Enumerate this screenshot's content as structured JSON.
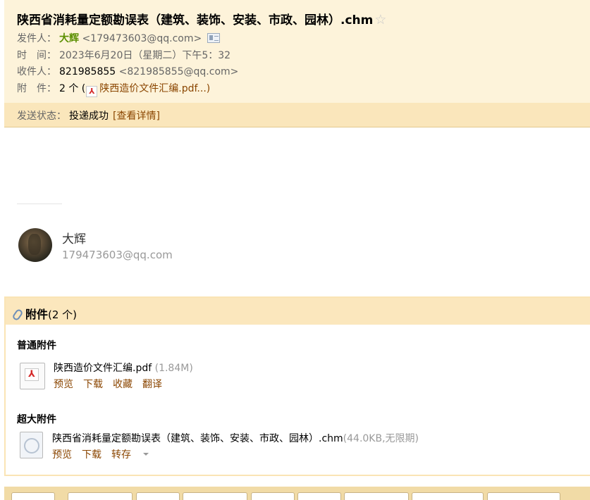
{
  "header": {
    "subject": "陕西省消耗量定额勘误表（建筑、装饰、安装、市政、园林）.chm",
    "star_icon": "☆",
    "from_label": "发件人：",
    "from_name": "大辉",
    "from_email": "<179473603@qq.com>",
    "time_label": "时　间：",
    "time_value": "2023年6月20日（星期二）下午5：32",
    "to_label": "收件人：",
    "to_name": "821985855",
    "to_email": "<821985855@qq.com>",
    "att_label": "附　件：",
    "att_count": "2 个 (",
    "att_first": "陕西造价文件汇编.pdf...)"
  },
  "status": {
    "label": "发送状态：",
    "value": "投递成功",
    "details_link": "[查看详情]"
  },
  "signature": {
    "name": "大辉",
    "email": "179473603@qq.com"
  },
  "attachments": {
    "title": "附件",
    "count": "(2 个)",
    "normal_section": "普通附件",
    "large_section": "超大附件",
    "normal_files": [
      {
        "name": "陕西造价文件汇编.pdf",
        "size": "(1.84M)",
        "actions": [
          "预览",
          "下载",
          "收藏",
          "翻译"
        ]
      }
    ],
    "large_files": [
      {
        "name": "陕西省消耗量定额勘误表（建筑、装饰、安装、市政、园林）.chm",
        "size": "(44.0KB,无限期)",
        "actions": [
          "预览",
          "下载",
          "转存"
        ]
      }
    ]
  },
  "colors": {
    "header_bg": "#fdf3da",
    "status_bg": "#fae6bb",
    "link": "#8a4500",
    "sender_green": "#5a8f00"
  }
}
